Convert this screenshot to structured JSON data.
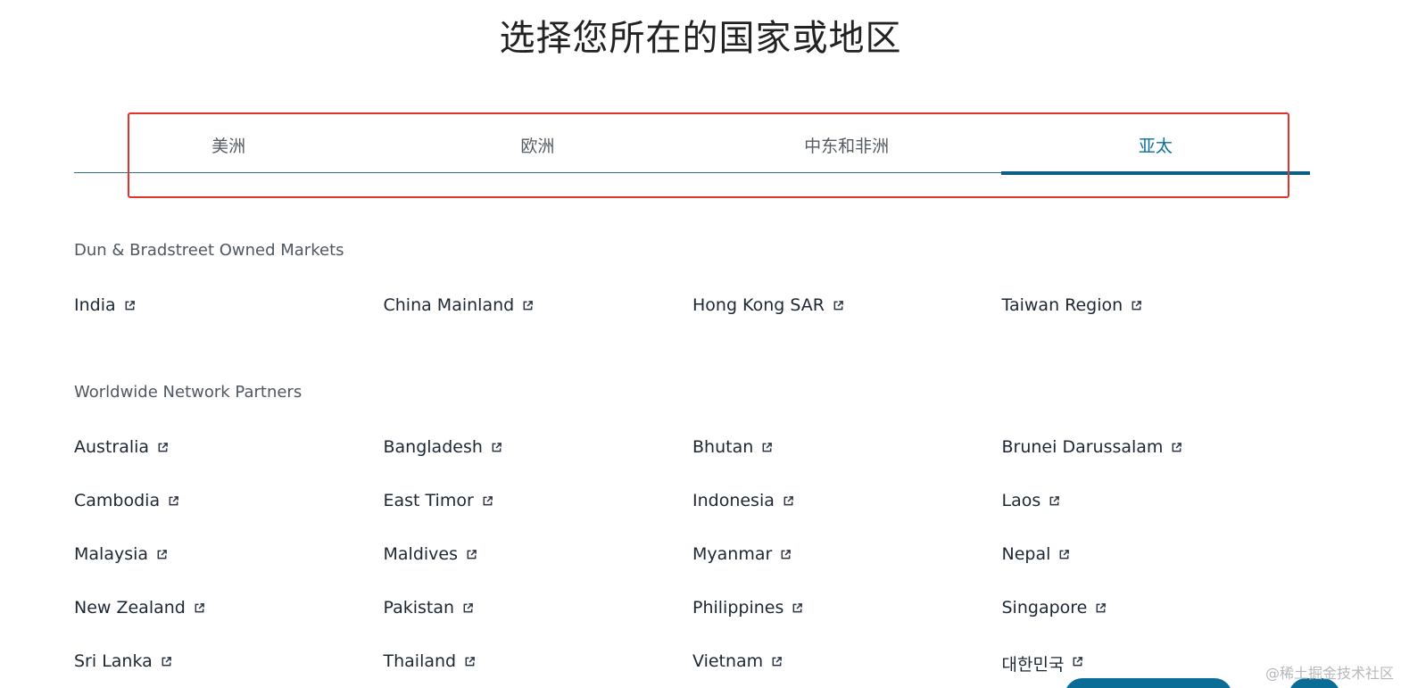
{
  "page": {
    "title": "选择您所在的国家或地区"
  },
  "tabs": [
    {
      "label": "美洲",
      "active": false
    },
    {
      "label": "欧洲",
      "active": false
    },
    {
      "label": "中东和非洲",
      "active": false
    },
    {
      "label": "亚太",
      "active": true
    }
  ],
  "sections": {
    "owned": {
      "title": "Dun & Bradstreet Owned Markets",
      "items": [
        "India",
        "China Mainland",
        "Hong Kong SAR",
        "Taiwan Region"
      ]
    },
    "partners": {
      "title": "Worldwide Network Partners",
      "items": [
        "Australia",
        "Bangladesh",
        "Bhutan",
        "Brunei Darussalam",
        "Cambodia",
        "East Timor",
        "Indonesia",
        "Laos",
        "Malaysia",
        "Maldives",
        "Myanmar",
        "Nepal",
        "New Zealand",
        "Pakistan",
        "Philippines",
        "Singapore",
        "Sri Lanka",
        "Thailand",
        "Vietnam",
        "대한민국"
      ]
    }
  },
  "icons": {
    "external_link": "external-link-icon"
  },
  "watermark": "@稀土掘金技术社区",
  "colors": {
    "accent": "#0a6f9a",
    "highlight": "#e0332e"
  }
}
